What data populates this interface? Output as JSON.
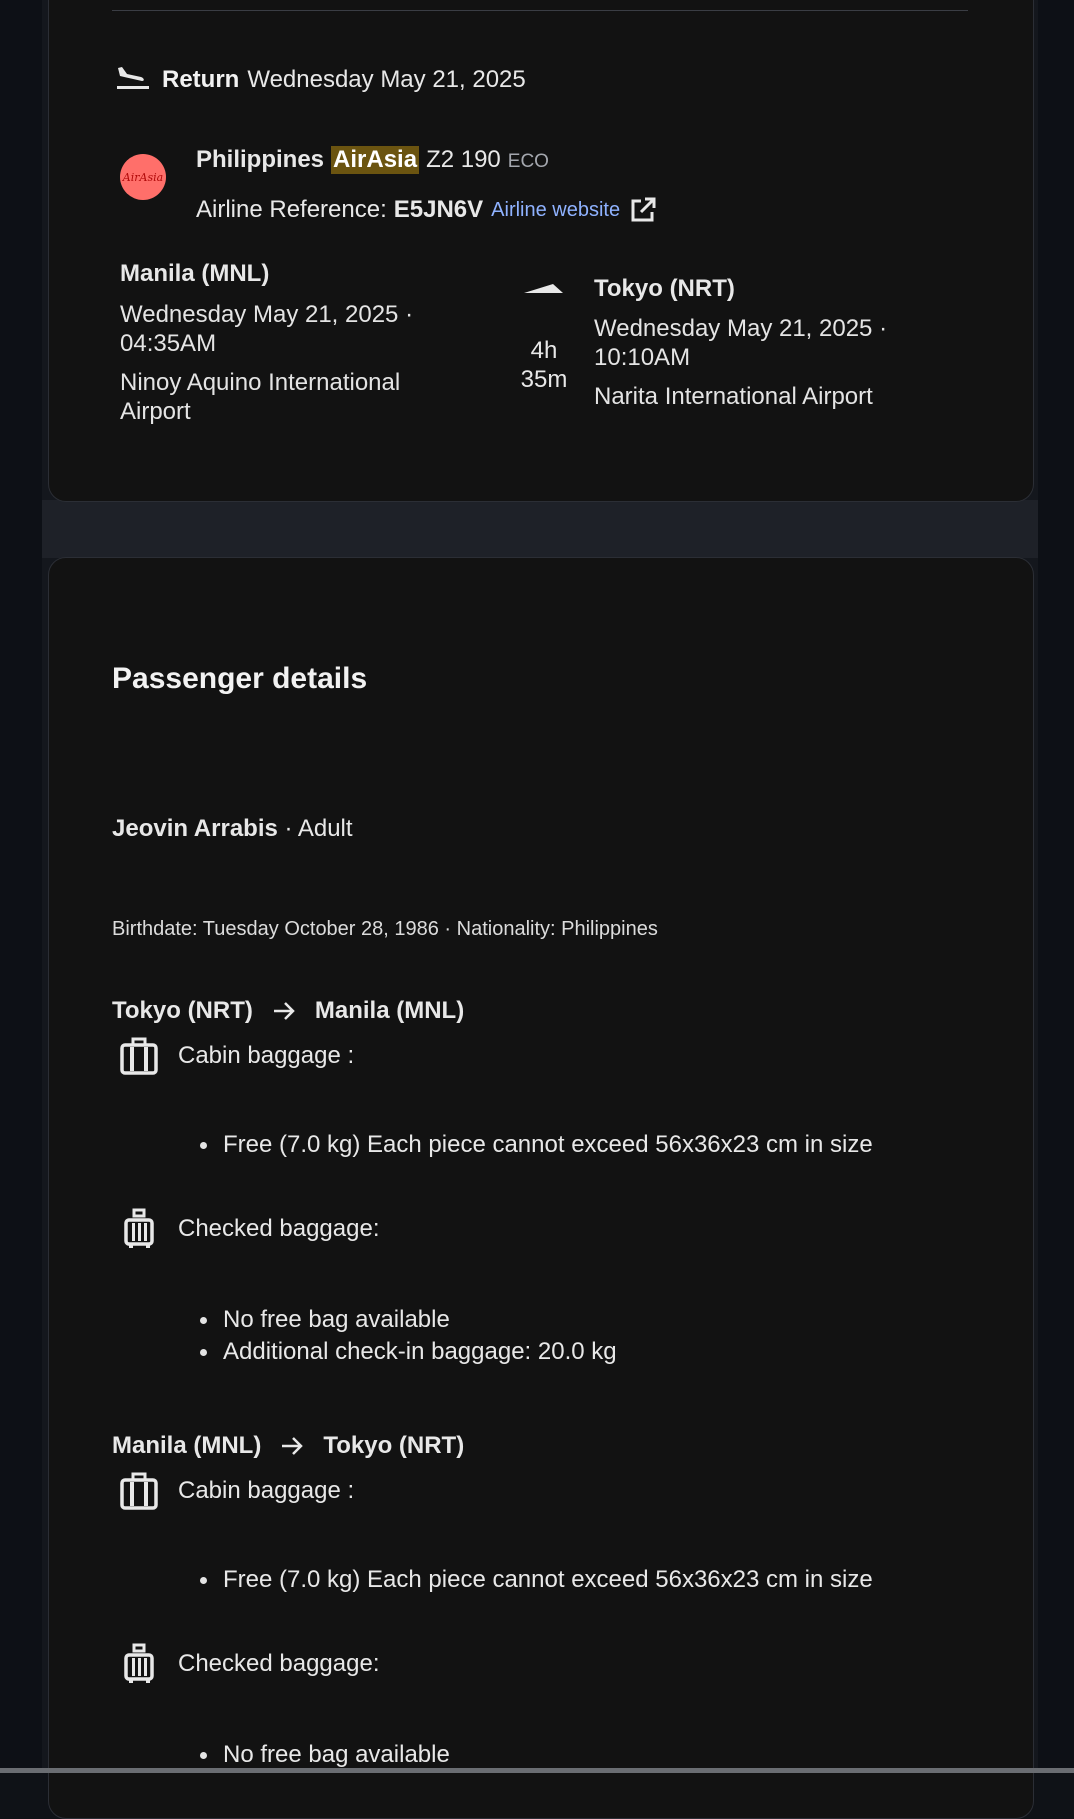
{
  "return_flight": {
    "label": "Return",
    "date": "Wednesday May 21, 2025",
    "airline_logo_text": "AirAsia",
    "airline_prefix": "Philippines",
    "airline_highlight": "AirAsia",
    "flight_number": "Z2 190",
    "cabin_class": "ECO",
    "ref_label": "Airline Reference:",
    "ref_code": "E5JN6V",
    "website_label": "Airline website",
    "departure": {
      "city": "Manila (MNL)",
      "datetime_line1": "Wednesday May 21, 2025 ·",
      "datetime_line2": "04:35AM",
      "airport_line1": "Ninoy Aquino International",
      "airport_line2": "Airport"
    },
    "duration_line1": "4h",
    "duration_line2": "35m",
    "arrival": {
      "city": "Tokyo (NRT)",
      "datetime_line1": "Wednesday May 21, 2025 ·",
      "datetime_line2": "10:10AM",
      "airport": "Narita International Airport"
    }
  },
  "passenger_section": {
    "title": "Passenger details",
    "passenger": {
      "name": "Jeovin Arrabis",
      "type_suffix": " · Adult",
      "details": "Birthdate: Tuesday October 28, 1986 · Nationality: Philippines"
    },
    "routes": [
      {
        "from": "Tokyo (NRT)",
        "to": "Manila (MNL)",
        "cabin_label": "Cabin baggage :",
        "cabin_items": [
          "Free (7.0 kg) Each piece cannot exceed 56x36x23 cm in size"
        ],
        "checked_label": "Checked baggage:",
        "checked_items": [
          "No free bag available",
          "Additional check-in baggage: 20.0 kg"
        ]
      },
      {
        "from": "Manila (MNL)",
        "to": "Tokyo (NRT)",
        "cabin_label": "Cabin baggage :",
        "cabin_items": [
          "Free (7.0 kg) Each piece cannot exceed 56x36x23 cm in size"
        ],
        "checked_label": "Checked baggage:",
        "checked_items": [
          "No free bag available"
        ]
      }
    ]
  },
  "colors": {
    "background": "#121212",
    "highlight": "#6b5410",
    "link": "#8fb2ff",
    "logo": "#ff6f6a"
  }
}
